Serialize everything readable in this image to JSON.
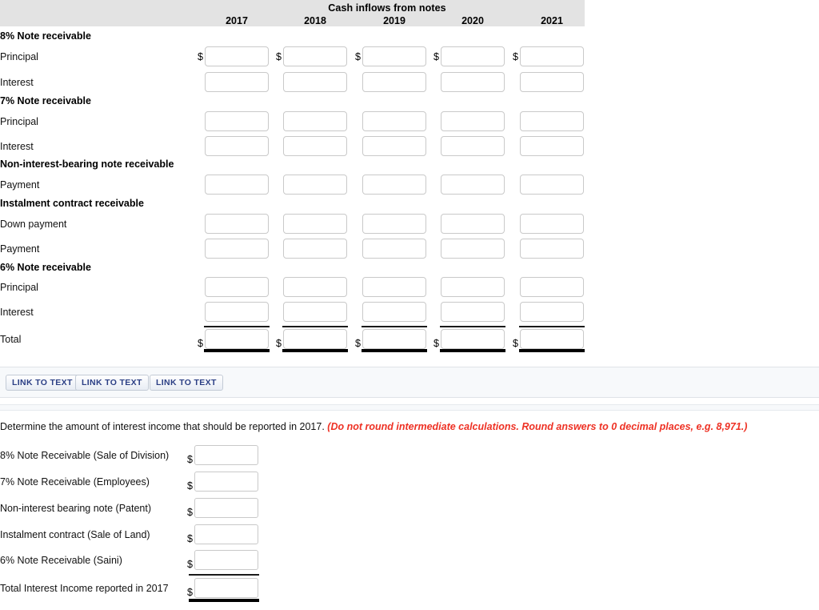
{
  "schedule": {
    "title": "Cash inflows from notes",
    "years": [
      "2017",
      "2018",
      "2019",
      "2020",
      "2021"
    ],
    "sections": [
      {
        "heading": "8% Note receivable",
        "rows": [
          {
            "label": "Principal",
            "dollar": true
          },
          {
            "label": "Interest",
            "dollar": false
          }
        ]
      },
      {
        "heading": "7% Note receivable",
        "rows": [
          {
            "label": "Principal",
            "dollar": false
          },
          {
            "label": "Interest",
            "dollar": false
          }
        ]
      },
      {
        "heading": "Non-interest-bearing note receivable",
        "rows": [
          {
            "label": "Payment",
            "dollar": false
          }
        ]
      },
      {
        "heading": "Instalment contract receivable",
        "rows": [
          {
            "label": "Down payment",
            "dollar": false
          },
          {
            "label": "Payment",
            "dollar": false
          }
        ]
      },
      {
        "heading": "6% Note receivable",
        "rows": [
          {
            "label": "Principal",
            "dollar": false
          },
          {
            "label": "Interest",
            "dollar": false
          }
        ]
      }
    ],
    "total_row": {
      "label": "Total",
      "dollar": true
    },
    "currency_symbol": "$",
    "cell_value": ""
  },
  "linkbar": {
    "buttons": [
      "LINK TO TEXT",
      "LINK TO TEXT",
      "LINK TO TEXT"
    ]
  },
  "question": {
    "text": "Determine the amount of interest income that should be reported in 2017.",
    "note": "(Do not round intermediate calculations. Round answers to 0 decimal places, e.g. 8,971.)",
    "note_color": "#ee3124",
    "rows": [
      {
        "label": "8% Note Receivable (Sale of Division)",
        "value": ""
      },
      {
        "label": "7% Note Receivable (Employees)",
        "value": ""
      },
      {
        "label": "Non-interest bearing note (Patent)",
        "value": ""
      },
      {
        "label": "Instalment contract (Sale of Land)",
        "value": ""
      },
      {
        "label": "6% Note Receivable (Saini)",
        "value": ""
      },
      {
        "label": "Total Interest Income reported in 2017",
        "value": ""
      }
    ],
    "currency_symbol": "$"
  }
}
